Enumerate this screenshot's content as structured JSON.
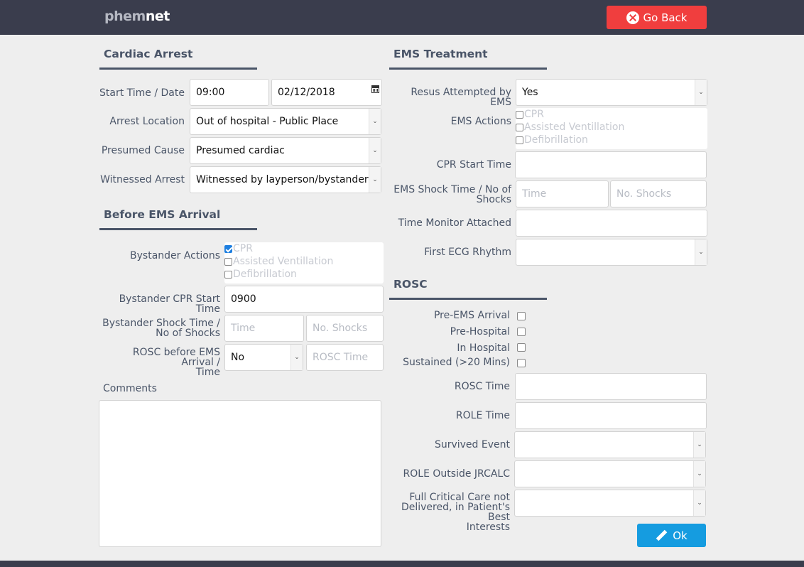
{
  "header": {
    "logo_part1": "phem",
    "logo_part2": "net",
    "go_back_label": "Go Back"
  },
  "cardiac_arrest": {
    "title": "Cardiac Arrest",
    "start_time_label": "Start Time / Date",
    "start_time": "09:00",
    "start_date": "02/12/2018",
    "arrest_location_label": "Arrest Location",
    "arrest_location": "Out of hospital - Public Place",
    "presumed_cause_label": "Presumed Cause",
    "presumed_cause": "Presumed cardiac",
    "witnessed_arrest_label": "Witnessed Arrest",
    "witnessed_arrest": "Witnessed by layperson/bystander"
  },
  "before_ems": {
    "title": "Before EMS Arrival",
    "bystander_actions_label": "Bystander Actions",
    "bystander_actions": [
      {
        "label": "CPR",
        "checked": true
      },
      {
        "label": "Assisted Ventillation",
        "checked": false
      },
      {
        "label": "Defibrillation",
        "checked": false
      }
    ],
    "cpr_start_label": "Bystander CPR Start Time",
    "cpr_start_value": "0900",
    "shock_label_1": "Bystander Shock Time /",
    "shock_label_2": "No of Shocks",
    "shock_time_placeholder": "Time",
    "shock_count_placeholder": "No. Shocks",
    "rosc_label_1": "ROSC before EMS Arrival /",
    "rosc_label_2": "Time",
    "rosc_value": "No",
    "rosc_time_placeholder": "ROSC Time",
    "comments_label": "Comments"
  },
  "ems_treatment": {
    "title": "EMS Treatment",
    "resus_label": "Resus Attempted by EMS",
    "resus_value": "Yes",
    "ems_actions_label": "EMS Actions",
    "ems_actions": [
      {
        "label": "CPR",
        "checked": false
      },
      {
        "label": "Assisted Ventillation",
        "checked": false
      },
      {
        "label": "Defibrillation",
        "checked": false
      }
    ],
    "cpr_start_label": "CPR Start Time",
    "shock_label_1": "EMS Shock Time / No of",
    "shock_label_2": "Shocks",
    "shock_time_placeholder": "Time",
    "shock_count_placeholder": "No. Shocks",
    "monitor_label": "Time Monitor Attached",
    "ecg_label": "First ECG Rhythm"
  },
  "rosc": {
    "title": "ROSC",
    "options": [
      {
        "label": "Pre-EMS Arrival",
        "checked": false
      },
      {
        "label": "Pre-Hospital",
        "checked": false
      },
      {
        "label": "In Hospital",
        "checked": false
      },
      {
        "label": "Sustained (>20 Mins)",
        "checked": false
      }
    ],
    "rosc_time_label": "ROSC Time",
    "role_time_label": "ROLE Time",
    "survived_label": "Survived Event",
    "role_outside_label": "ROLE Outside JRCALC",
    "full_care_label_1": "Full Critical Care not",
    "full_care_label_2": "Delivered, in Patient's Best",
    "full_care_label_3": "Interests"
  },
  "ok_label": "Ok"
}
